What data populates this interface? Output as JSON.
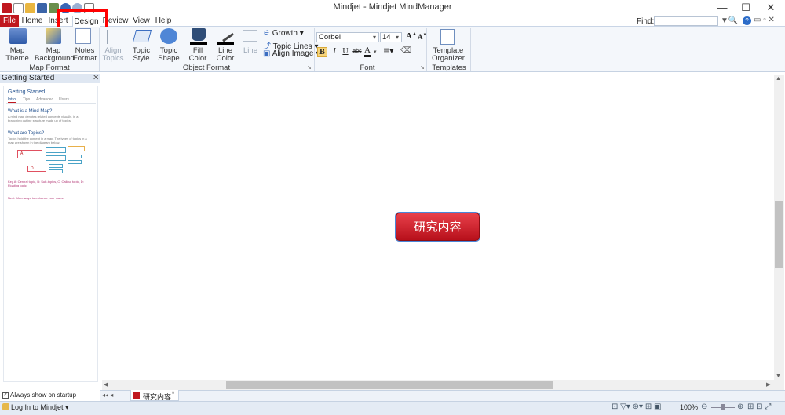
{
  "window": {
    "title": "Mindjet - Mindjet MindManager",
    "minimize": "—",
    "maximize": "☐",
    "close": "✕"
  },
  "menu": {
    "file": "File",
    "tabs": [
      "Home",
      "Insert",
      "Design",
      "Review",
      "View",
      "Help"
    ],
    "find_label": "Find:"
  },
  "ribbon": {
    "map_theme": "Map Theme",
    "map_background": "Map Background",
    "notes_format": "Notes Format",
    "align_topics": "Align Topics",
    "topic_style": "Topic Style",
    "topic_shape": "Topic Shape",
    "fill_color": "Fill Color",
    "line_color": "Line Color",
    "line": "Line",
    "growth": "Growth",
    "topic_lines": "Topic Lines",
    "align_image": "Align Image",
    "font_name": "Corbel",
    "font_size": "14",
    "bold": "B",
    "italic": "I",
    "underline": "U",
    "strike": "abc",
    "template_organizer": "Template Organizer",
    "groups": {
      "map_format": "Map Format",
      "object_format": "Object Format",
      "font": "Font",
      "templates": "Templates"
    }
  },
  "sidebar": {
    "header": "Getting Started",
    "panel_title": "Getting Started",
    "subtabs": [
      "Intro",
      "Tips",
      "Advanced",
      "Users"
    ],
    "q1": "What is a Mind Map?",
    "q1_text": "A mind map denotes related concepts visually, in a branching outline structure made up of topics.",
    "q2": "What are Topics?",
    "q2_text": "Topics hold the content in a map. The types of topics in a map are shown in the diagram below.",
    "diagram_a": "A",
    "diagram_d": "D",
    "key": "Key A: Central topic, B: Sub-topics, C: Callout topic, D: Floating topic",
    "next": "Next: More ways to enhance your maps",
    "always_show": "Always show on startup"
  },
  "canvas": {
    "central_topic": "研究内容"
  },
  "docbar": {
    "doc_tab": "研究内容",
    "doc_tab_close": "*"
  },
  "status": {
    "login": "Log In to Mindjet",
    "zoom": "100%"
  },
  "colors": {
    "accent": "#c0181f",
    "highlight": "#ff0000",
    "ribbon_bg": "#f4f7fb"
  }
}
